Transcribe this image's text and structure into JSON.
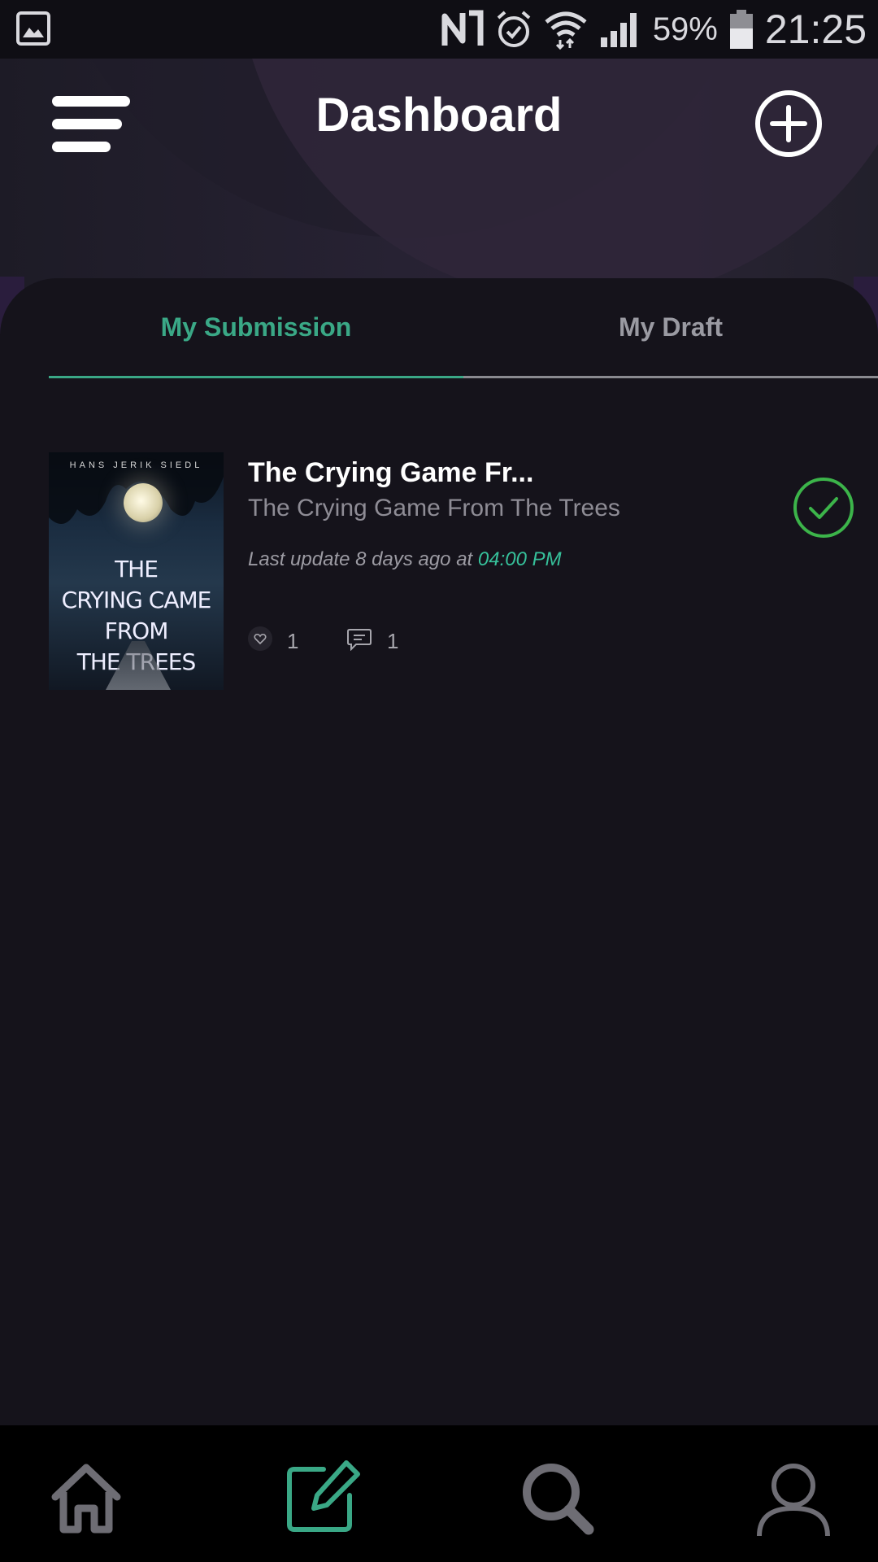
{
  "status_bar": {
    "battery": "59%",
    "time": "21:25",
    "icons": [
      "gallery-icon",
      "nfc-icon",
      "alarm-icon",
      "wifi-icon",
      "signal-icon",
      "battery-icon"
    ]
  },
  "header": {
    "title": "Dashboard",
    "menu_icon": "hamburger-menu-icon",
    "add_icon": "add-circle-icon"
  },
  "tabs": [
    {
      "label": "My Submission",
      "active": true
    },
    {
      "label": "My Draft",
      "active": false
    }
  ],
  "submissions": [
    {
      "title": "The Crying Game Fr...",
      "subtitle": "The Crying Game From The Trees",
      "meta_prefix": "Last update 8 days ago at",
      "meta_time": "04:00 PM",
      "likes": "1",
      "comments": "1",
      "cover": {
        "author": "HANS JERIK SIEDL",
        "title_lines": [
          "THE",
          "CRYING CAME",
          "FROM",
          "THE TREES"
        ]
      },
      "status": "approved"
    }
  ],
  "bottom_nav": [
    {
      "name": "home",
      "icon": "home-icon",
      "active": false
    },
    {
      "name": "write",
      "icon": "edit-icon",
      "active": true
    },
    {
      "name": "search",
      "icon": "search-icon",
      "active": false
    },
    {
      "name": "profile",
      "icon": "user-icon",
      "active": false
    }
  ],
  "colors": {
    "accent": "#3aa886",
    "check": "#3cb44a",
    "background": "#14121a"
  }
}
